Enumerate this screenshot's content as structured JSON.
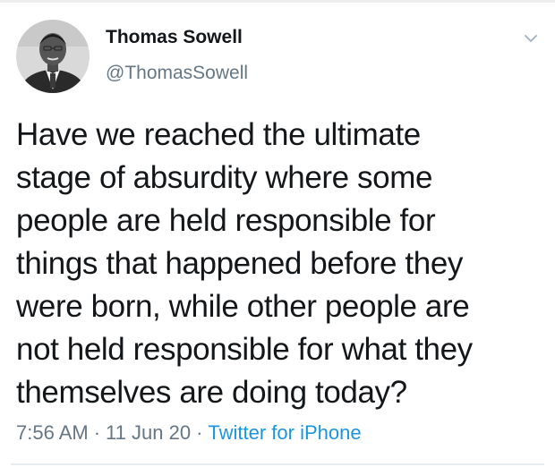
{
  "author": {
    "name": "Thomas Sowell",
    "handle": "@ThomasSowell"
  },
  "icons": {
    "menu": "chevron-down-icon",
    "avatar": "profile-photo"
  },
  "tweet": {
    "lines": [
      "Have we reached the ultimate",
      "stage of absurdity where some",
      "people are held responsible for",
      "things that happened before they",
      "were born, while other people are",
      "not held responsible for what they",
      "themselves are doing today?"
    ]
  },
  "meta": {
    "time": "7:56 AM",
    "separator": "·",
    "date": "11 Jun 20",
    "source": "Twitter for iPhone"
  },
  "colors": {
    "text": "#14171a",
    "secondary": "#657786",
    "link": "#1b95e0",
    "divider": "#e6ecf0"
  }
}
